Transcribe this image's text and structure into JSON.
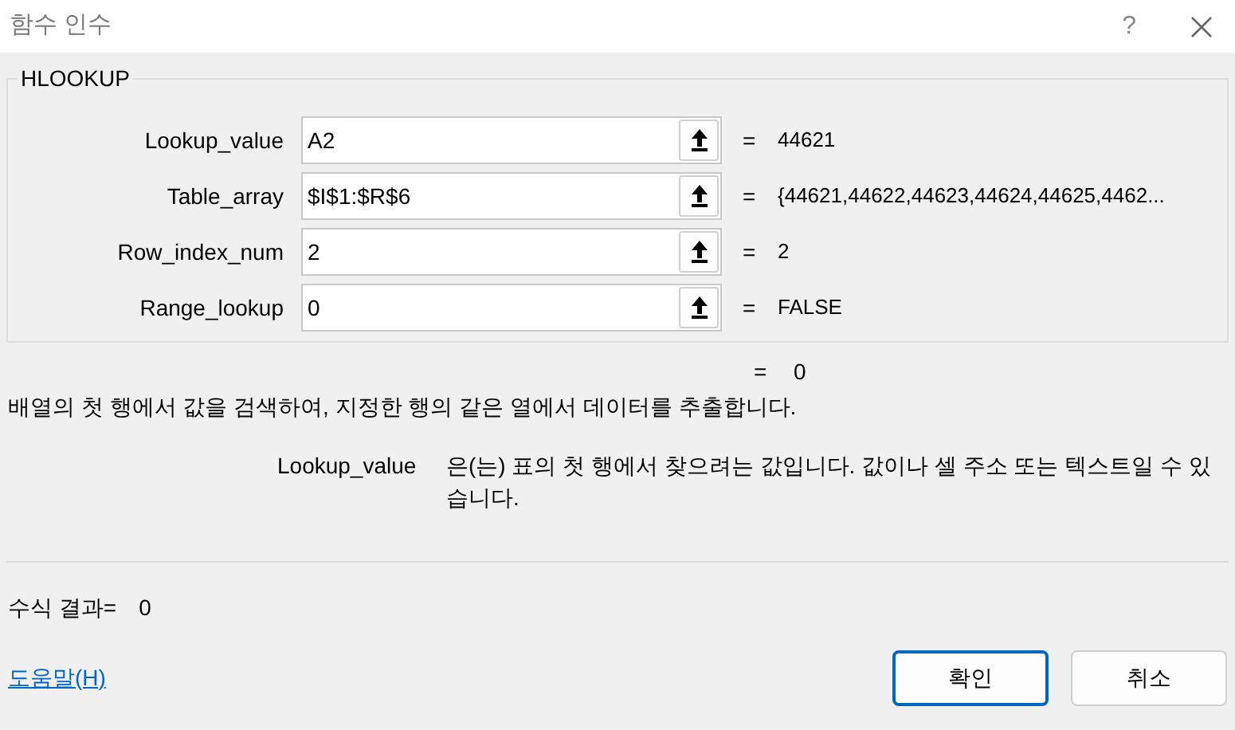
{
  "window": {
    "title": "함수 인수",
    "help": "?"
  },
  "group": {
    "title": "HLOOKUP"
  },
  "arguments": [
    {
      "label": "Lookup_value",
      "value": "A2",
      "equals": "=",
      "result": "44621"
    },
    {
      "label": "Table_array",
      "value": "$I$1:$R$6",
      "equals": "=",
      "result": "{44621,44622,44623,44624,44625,4462..."
    },
    {
      "label": "Row_index_num",
      "value": "2",
      "equals": "=",
      "result": "2"
    },
    {
      "label": "Range_lookup",
      "value": "0",
      "equals": "=",
      "result": "FALSE"
    }
  ],
  "function_result": {
    "equals": "=",
    "value": "0"
  },
  "description": "배열의 첫 행에서 값을 검색하여, 지정한 행의 같은 열에서 데이터를 추출합니다.",
  "argument_help": {
    "name": "Lookup_value",
    "text": "은(는) 표의 첫 행에서 찾으려는 값입니다. 값이나 셀 주소 또는 텍스트일 수 있습니다."
  },
  "formula_result": {
    "label": "수식 결과=",
    "value": "0"
  },
  "help_link": "도움말(H)",
  "buttons": [
    {
      "label": "확인",
      "default": true
    },
    {
      "label": "취소",
      "default": false
    }
  ]
}
